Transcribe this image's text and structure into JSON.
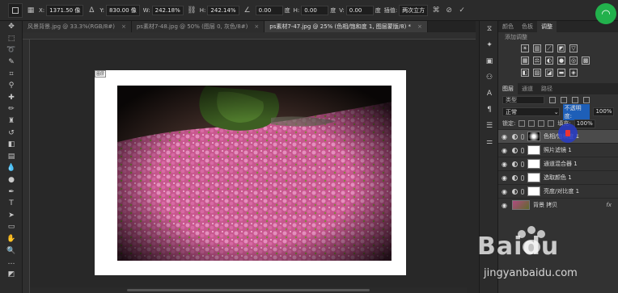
{
  "options_bar": {
    "x_label": "X:",
    "x_value": "1371.50 像",
    "y_label": "Y:",
    "y_value": "830.00 像",
    "w_label": "W:",
    "w_value": "242.18%",
    "h_label": "H:",
    "h_value": "242.14%",
    "angle_value": "0.00",
    "angle_unit": "度",
    "hskew_label": "H:",
    "hskew_value": "0.00",
    "hskew_unit": "度",
    "vskew_label": "V:",
    "vskew_value": "0.00",
    "vskew_unit": "度",
    "interp_label": "插值:",
    "interp_value": "两次立方"
  },
  "doc_tabs": [
    {
      "label": "风景背景.jpg @ 33.3%(RGB/8#)"
    },
    {
      "label": "ps素材7-48.jpg @ 50% (图层 0, 灰色/8#)"
    },
    {
      "label": "ps素材7-47.jpg @ 25% (色相/饱和度 1, 图层蒙版/8) *"
    }
  ],
  "doc_small_label": "图层",
  "right_tabs": [
    "颜色",
    "色板",
    "调整"
  ],
  "adjustments_title": "添加调整",
  "layers_tabs": [
    "图层",
    "通道",
    "路径"
  ],
  "layers_kind": "类型",
  "blend_mode": "正常",
  "opacity_label": "不透明度:",
  "opacity_value": "100%",
  "lock_label": "锁定:",
  "fill_label": "填充:",
  "fill_value": "100%",
  "layers": [
    {
      "name": "色相/饱和度 1"
    },
    {
      "name": "照片滤镜 1"
    },
    {
      "name": "通道混合器 1"
    },
    {
      "name": "选取颜色 1"
    },
    {
      "name": "亮度/对比度 1"
    },
    {
      "name": "背景 拷贝"
    }
  ],
  "layer_fx": "fx",
  "watermark": {
    "brand": "Baidu",
    "url": "jingyanbaidu.com"
  }
}
